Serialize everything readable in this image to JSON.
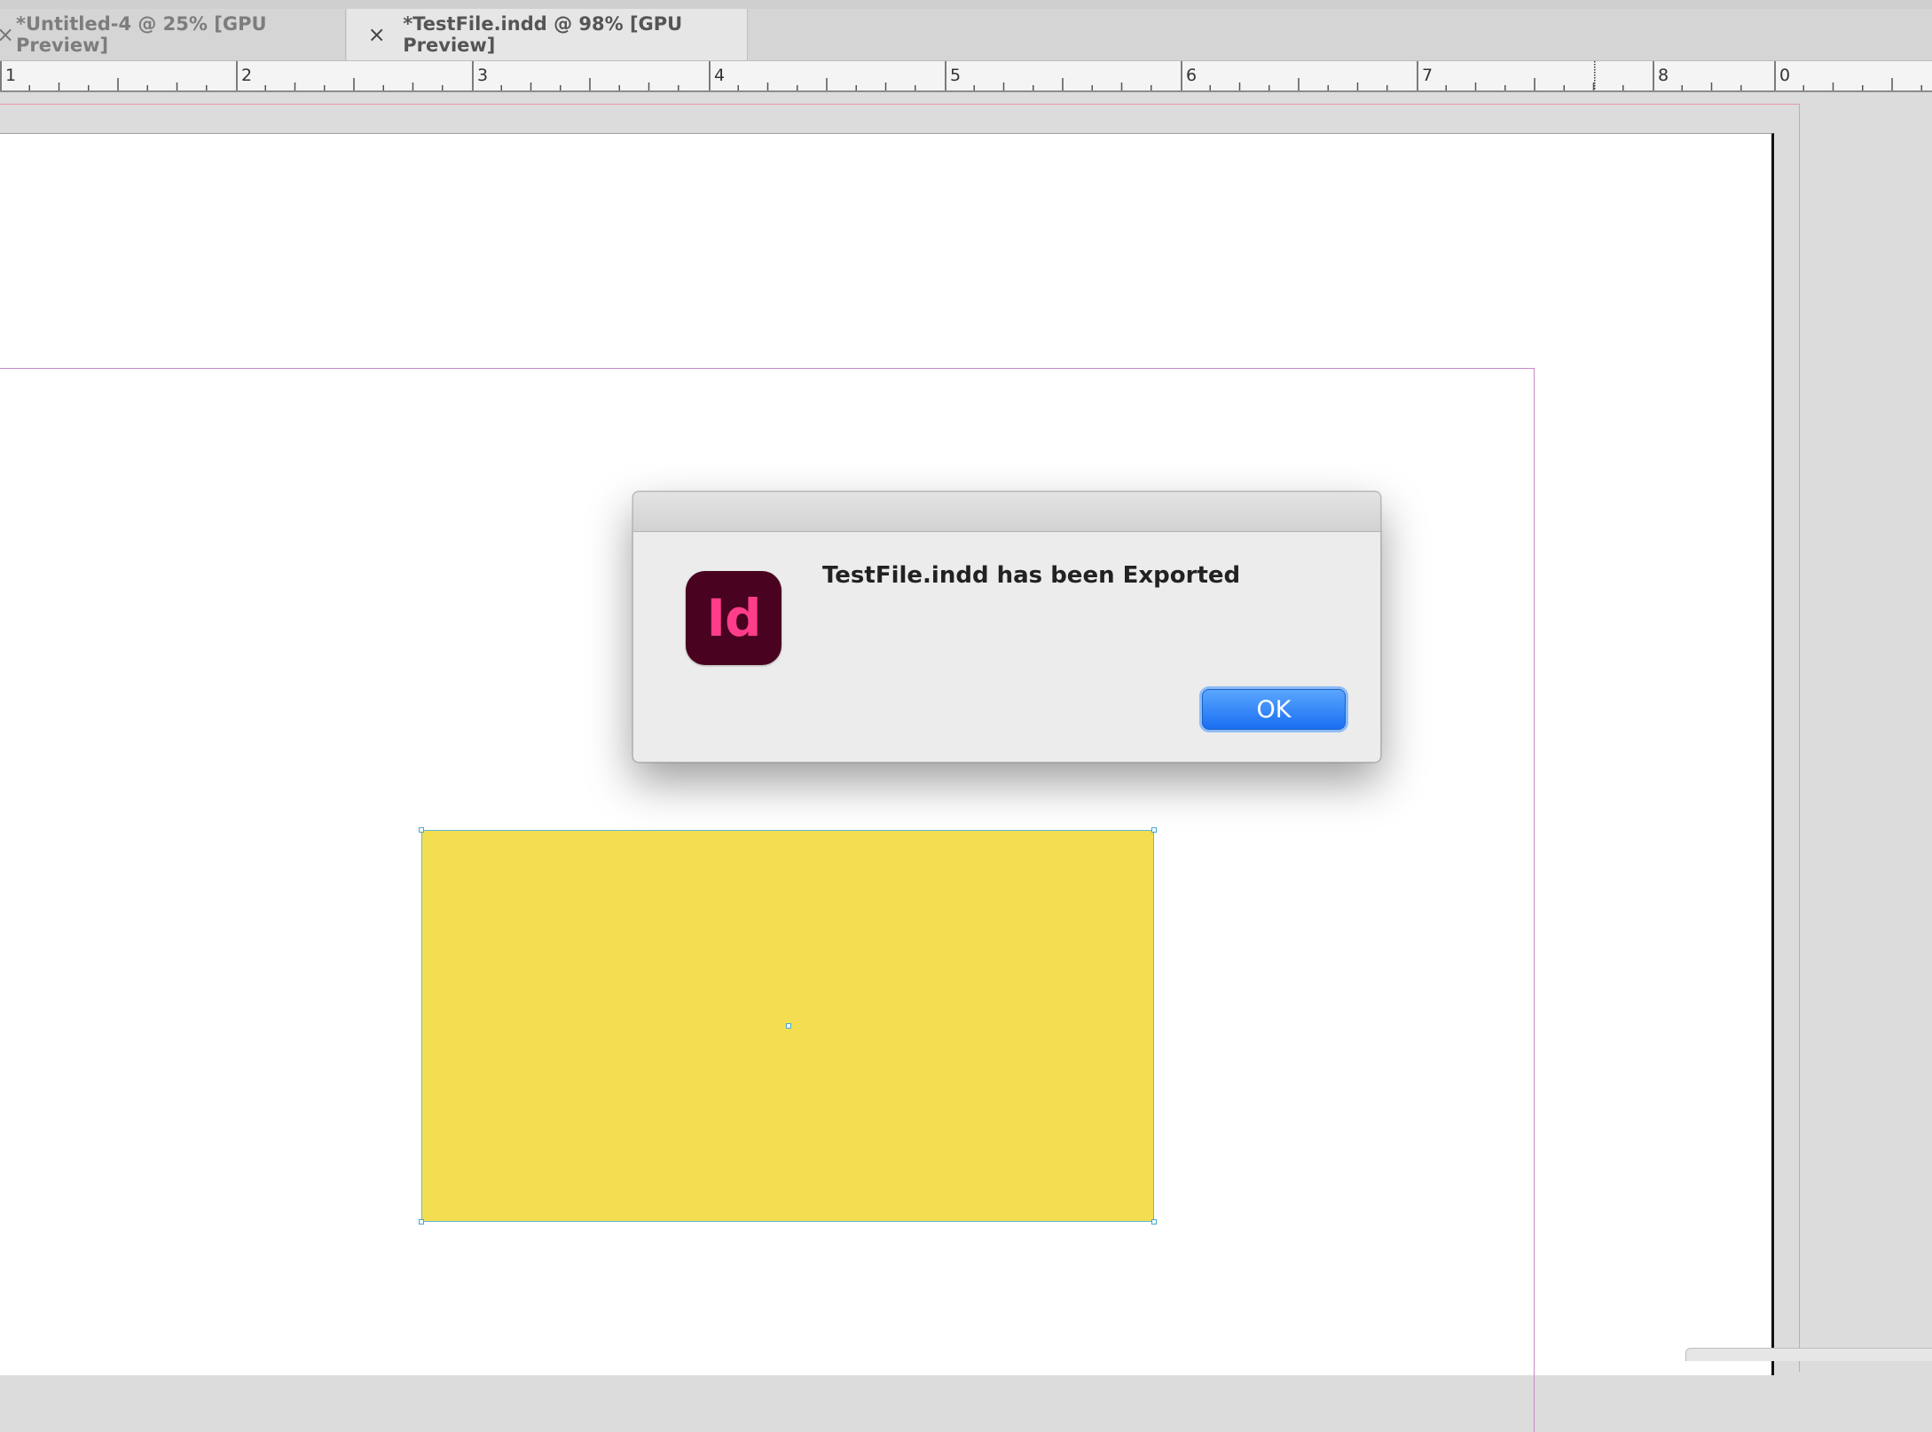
{
  "tabs": [
    {
      "label": "*Untitled-4 @ 25% [GPU Preview]",
      "close_glyph": "×",
      "active": false
    },
    {
      "label": "*TestFile.indd @ 98% [GPU Preview]",
      "close_glyph": "×",
      "active": true
    }
  ],
  "ruler": {
    "labels": [
      "1",
      "2",
      "3",
      "4",
      "5",
      "6",
      "7",
      "8",
      "0"
    ]
  },
  "document": {
    "selected_object": "yellow-rectangle",
    "fill_color": "#f3de52"
  },
  "dialog": {
    "app_icon_text": "Id",
    "app_icon_colors": {
      "background": "#49021f",
      "text": "#ff3d8b"
    },
    "message": "TestFile.indd has been Exported",
    "ok_label": "OK",
    "ok_color": "#1a6ff2"
  }
}
